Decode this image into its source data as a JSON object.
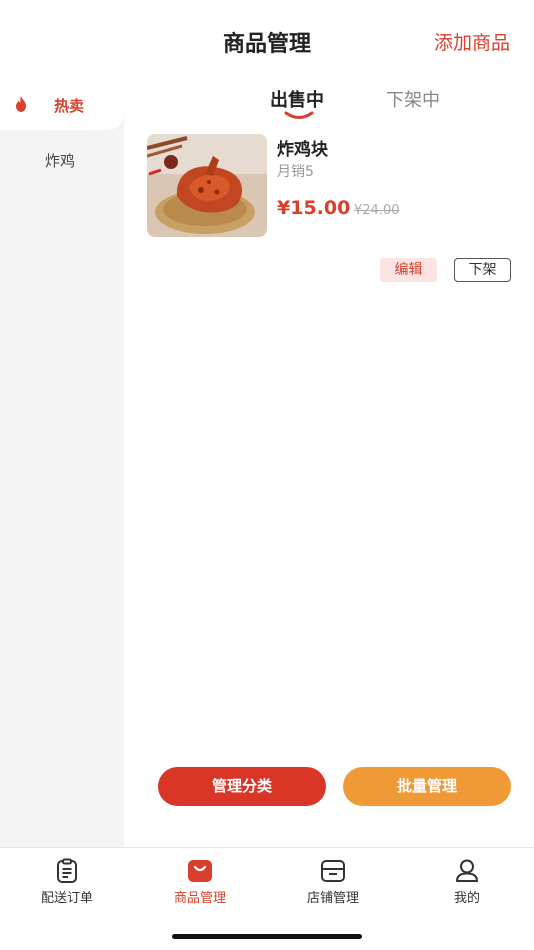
{
  "header": {
    "title": "商品管理",
    "add_label": "添加商品"
  },
  "sidebar": {
    "items": [
      {
        "label": "热卖"
      },
      {
        "label": "炸鸡"
      }
    ]
  },
  "tabs": [
    {
      "label": "出售中"
    },
    {
      "label": "下架中"
    }
  ],
  "product": {
    "name": "炸鸡块",
    "monthly_sales": "月销5",
    "price": "¥15.00",
    "original_price": "¥24.00",
    "edit_label": "编辑",
    "delist_label": "下架"
  },
  "actions": {
    "manage_category": "管理分类",
    "batch_manage": "批量管理"
  },
  "tabbar": {
    "items": [
      {
        "label": "配送订单",
        "icon": "clipboard-icon"
      },
      {
        "label": "商品管理",
        "icon": "shopping-bag-icon"
      },
      {
        "label": "店铺管理",
        "icon": "store-icon"
      },
      {
        "label": "我的",
        "icon": "user-icon"
      }
    ]
  },
  "colors": {
    "accent": "#d8402d",
    "secondary": "#ef9a36"
  }
}
